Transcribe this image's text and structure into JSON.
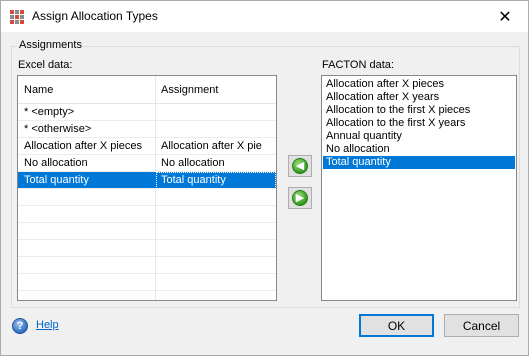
{
  "window": {
    "title": "Assign Allocation Types",
    "close_glyph": "✕"
  },
  "group": {
    "title": "Assignments"
  },
  "excel": {
    "label": "Excel data:",
    "columns": [
      "Name",
      "Assignment"
    ],
    "rows": [
      {
        "name": "* <empty>",
        "assignment": ""
      },
      {
        "name": "* <otherwise>",
        "assignment": ""
      },
      {
        "name": "Allocation after X pieces",
        "assignment": "Allocation after X pie"
      },
      {
        "name": "No allocation",
        "assignment": "No allocation"
      },
      {
        "name": "Total quantity",
        "assignment": "Total quantity"
      }
    ],
    "selected_index": 4
  },
  "arrows": {
    "left_glyph": "◀",
    "right_glyph": "▶"
  },
  "facton": {
    "label": "FACTON data:",
    "items": [
      "Allocation after X pieces",
      "Allocation after X years",
      "Allocation to the first X pieces",
      "Allocation to the first X years",
      "Annual quantity",
      "No allocation",
      "Total quantity"
    ],
    "selected_index": 6
  },
  "footer": {
    "help_label": "Help",
    "help_glyph": "?",
    "ok_label": "OK",
    "cancel_label": "Cancel"
  },
  "colors": {
    "selection": "#0078d7",
    "link": "#0066cc",
    "arrow_green": "#2e9a1e"
  },
  "icons": {
    "app": "grid-app-icon",
    "help": "question-mark-icon",
    "arrow_left": "green-arrow-left-icon",
    "arrow_right": "green-arrow-right-icon"
  }
}
